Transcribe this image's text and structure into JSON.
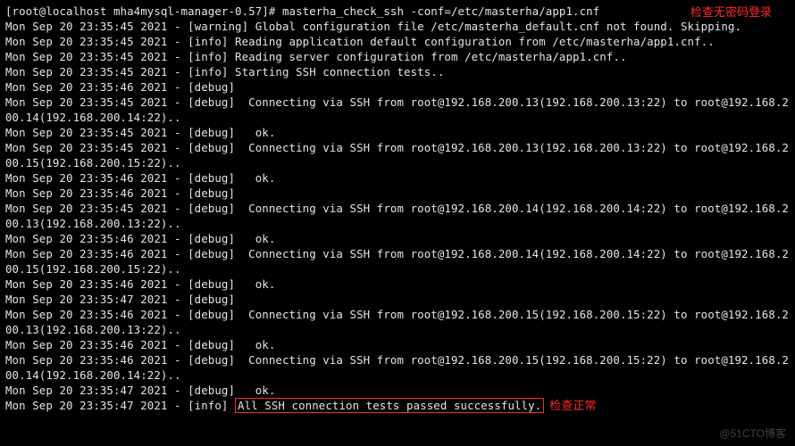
{
  "prompt_line": "[root@localhost mha4mysql-manager-0.57]# masterha_check_ssh -conf=/etc/masterha/app1.cnf",
  "annotation_top": "检查无密码登录",
  "lines": [
    "Mon Sep 20 23:35:45 2021 - [warning] Global configuration file /etc/masterha_default.cnf not found. Skipping.",
    "Mon Sep 20 23:35:45 2021 - [info] Reading application default configuration from /etc/masterha/app1.cnf..",
    "Mon Sep 20 23:35:45 2021 - [info] Reading server configuration from /etc/masterha/app1.cnf..",
    "Mon Sep 20 23:35:45 2021 - [info] Starting SSH connection tests..",
    "Mon Sep 20 23:35:46 2021 - [debug]",
    "Mon Sep 20 23:35:45 2021 - [debug]  Connecting via SSH from root@192.168.200.13(192.168.200.13:22) to root@192.168.200.14(192.168.200.14:22)..",
    "Mon Sep 20 23:35:45 2021 - [debug]   ok.",
    "Mon Sep 20 23:35:45 2021 - [debug]  Connecting via SSH from root@192.168.200.13(192.168.200.13:22) to root@192.168.200.15(192.168.200.15:22)..",
    "Mon Sep 20 23:35:46 2021 - [debug]   ok.",
    "Mon Sep 20 23:35:46 2021 - [debug]",
    "Mon Sep 20 23:35:45 2021 - [debug]  Connecting via SSH from root@192.168.200.14(192.168.200.14:22) to root@192.168.200.13(192.168.200.13:22)..",
    "Mon Sep 20 23:35:46 2021 - [debug]   ok.",
    "Mon Sep 20 23:35:46 2021 - [debug]  Connecting via SSH from root@192.168.200.14(192.168.200.14:22) to root@192.168.200.15(192.168.200.15:22)..",
    "Mon Sep 20 23:35:46 2021 - [debug]   ok.",
    "Mon Sep 20 23:35:47 2021 - [debug]",
    "Mon Sep 20 23:35:46 2021 - [debug]  Connecting via SSH from root@192.168.200.15(192.168.200.15:22) to root@192.168.200.13(192.168.200.13:22)..",
    "Mon Sep 20 23:35:46 2021 - [debug]   ok.",
    "Mon Sep 20 23:35:46 2021 - [debug]  Connecting via SSH from root@192.168.200.15(192.168.200.15:22) to root@192.168.200.14(192.168.200.14:22)..",
    "Mon Sep 20 23:35:47 2021 - [debug]   ok."
  ],
  "final_prefix": "Mon Sep 20 23:35:47 2021 - [info] ",
  "final_highlight": "All SSH connection tests passed successfully.",
  "annotation_bottom": "检查正常",
  "watermark": "@51CTO博客"
}
